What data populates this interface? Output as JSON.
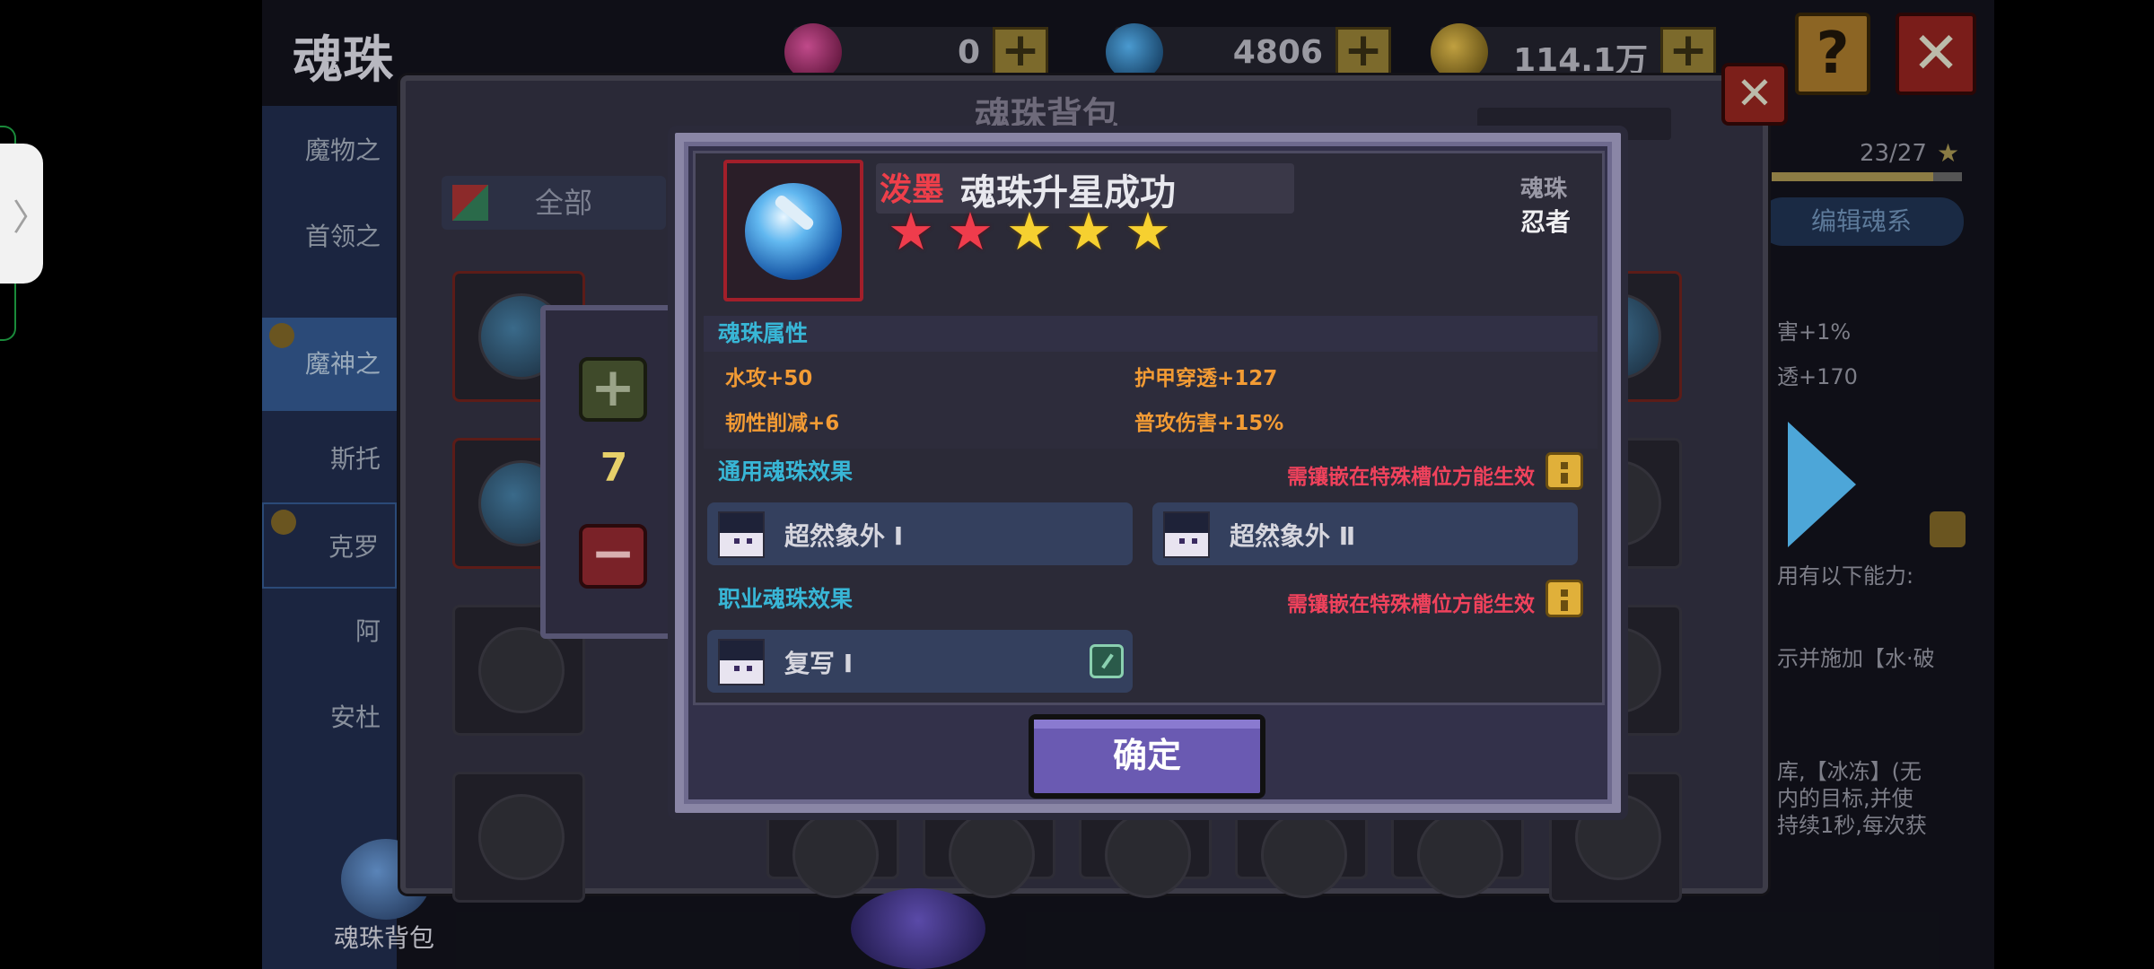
{
  "header": {
    "title": "魂珠",
    "currencies": [
      {
        "icon": "pink-gem-icon",
        "value": "0"
      },
      {
        "icon": "blue-crystal-icon",
        "value": "4806"
      },
      {
        "icon": "gold-coin-icon",
        "value": "114.1万"
      }
    ],
    "help_label": "?",
    "close_label": "✕"
  },
  "sidebar": {
    "items": [
      {
        "label": "魔物之",
        "locked": false,
        "active": false
      },
      {
        "label": "首领之",
        "locked": false,
        "active": false
      },
      {
        "label": "魔神之",
        "locked": true,
        "active": true
      },
      {
        "label": "斯托",
        "locked": false,
        "active": false
      },
      {
        "label": "克罗",
        "locked": true,
        "active": false
      },
      {
        "label": "阿",
        "locked": false,
        "active": false
      },
      {
        "label": "安杜",
        "locked": false,
        "active": false
      }
    ],
    "bottom_label": "魂珠背包"
  },
  "backpack": {
    "title": "魂珠背包",
    "close_label": "✕",
    "filter_label": "全部"
  },
  "right_panel": {
    "progress_text": "23/27",
    "progress_value": 0.85,
    "edit_label": "编辑魂系",
    "lines": [
      "害+1%",
      "透+170",
      "用有以下能力:",
      "示并施加【水·破",
      "库,【冰冻】(无",
      "内的目标,并使",
      "持续1秒,每次获"
    ]
  },
  "quantity": {
    "plus_label": "+",
    "value": "7",
    "minus_label": "−"
  },
  "dialog": {
    "name_prefix": "泼墨",
    "title": "魂珠升星成功",
    "stars": {
      "total": 5,
      "red": 2,
      "gold": 3
    },
    "category_label": "魂珠",
    "category_value": "忍者",
    "attributes_header": "魂珠属性",
    "attributes": [
      "水攻+50",
      "护甲穿透+127",
      "韧性削减+6",
      "普攻伤害+15%"
    ],
    "general_header": "通用魂珠效果",
    "general_note": "需镶嵌在特殊槽位方能生效",
    "general_effects": [
      "超然象外 Ⅰ",
      "超然象外 Ⅱ"
    ],
    "class_header": "职业魂珠效果",
    "class_note": "需镶嵌在特殊槽位方能生效",
    "class_effects": [
      "复写 Ⅰ"
    ],
    "confirm_label": "确定"
  },
  "colors": {
    "accent_cyan": "#38b6d6",
    "attribute_orange": "#f29b34",
    "warning_red": "#f0425c",
    "star_gold": "#f6d030",
    "star_red": "#ef3c4c",
    "button_purple": "#6a5ab2"
  },
  "edge_handle_label": "〉"
}
